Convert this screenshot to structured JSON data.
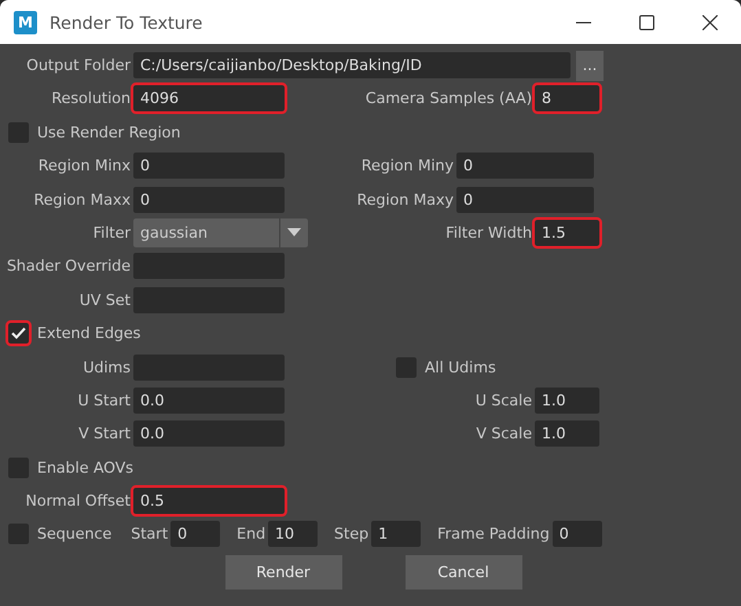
{
  "window": {
    "title": "Render To Texture",
    "app_icon_letter": "M"
  },
  "rows": [
    {
      "kind": "path",
      "label": "Output Folder",
      "value": "C:/Users/caijianbo/Desktop/Baking/ID",
      "button": "..."
    },
    {
      "kind": "pair",
      "left": {
        "label": "Resolution",
        "value": "4096",
        "highlighted": true
      },
      "right": {
        "label": "Camera Samples (AA)",
        "value": "8",
        "highlighted": true
      }
    },
    {
      "kind": "checkbox",
      "label": "Use Render Region",
      "checked": false,
      "highlighted": false
    },
    {
      "kind": "region",
      "left": {
        "label": "Region Minx",
        "value": "0",
        "highlighted": false
      },
      "right": {
        "label": "Region Miny",
        "value": "0",
        "highlighted": false
      }
    },
    {
      "kind": "region",
      "left": {
        "label": "Region Maxx",
        "value": "0",
        "highlighted": false
      },
      "right": {
        "label": "Region Maxy",
        "value": "0",
        "highlighted": false
      }
    },
    {
      "kind": "dropdown",
      "label": "Filter",
      "value": "gaussian",
      "right": {
        "label": "Filter Width",
        "value": "1.5",
        "highlighted": true
      }
    },
    {
      "kind": "field",
      "left": {
        "label": "Shader Override",
        "highlighted": false
      }
    },
    {
      "kind": "field",
      "left": {
        "label": "UV Set",
        "highlighted": false
      }
    },
    {
      "kind": "checkbox",
      "label": "Extend Edges",
      "checked": true,
      "highlighted": true
    },
    {
      "kind": "udims",
      "left": {
        "label": "Udims",
        "highlighted": false
      },
      "check": {
        "label": "All Udims",
        "checked": false
      }
    },
    {
      "kind": "pair",
      "left": {
        "label": "U Start",
        "value": "0.0",
        "highlighted": false
      },
      "right": {
        "label": "U Scale",
        "value": "1.0",
        "highlighted": false
      }
    },
    {
      "kind": "pair",
      "left": {
        "label": "V Start",
        "value": "0.0",
        "highlighted": false
      },
      "right": {
        "label": "V Scale",
        "value": "1.0",
        "highlighted": false
      }
    },
    {
      "kind": "checkbox",
      "label": "Enable AOVs",
      "checked": false,
      "highlighted": false
    },
    {
      "kind": "field",
      "left": {
        "label": "Normal Offset",
        "value": "0.5",
        "highlighted": true
      }
    },
    {
      "kind": "sequence",
      "label": "Sequence",
      "checked": false,
      "fields": [
        {
          "label": "Start",
          "value": "0"
        },
        {
          "label": "End",
          "value": "10"
        },
        {
          "label": "Step",
          "value": "1"
        },
        {
          "label": "Frame Padding",
          "value": "0"
        }
      ]
    }
  ],
  "buttons": [
    "Render",
    "Cancel"
  ]
}
